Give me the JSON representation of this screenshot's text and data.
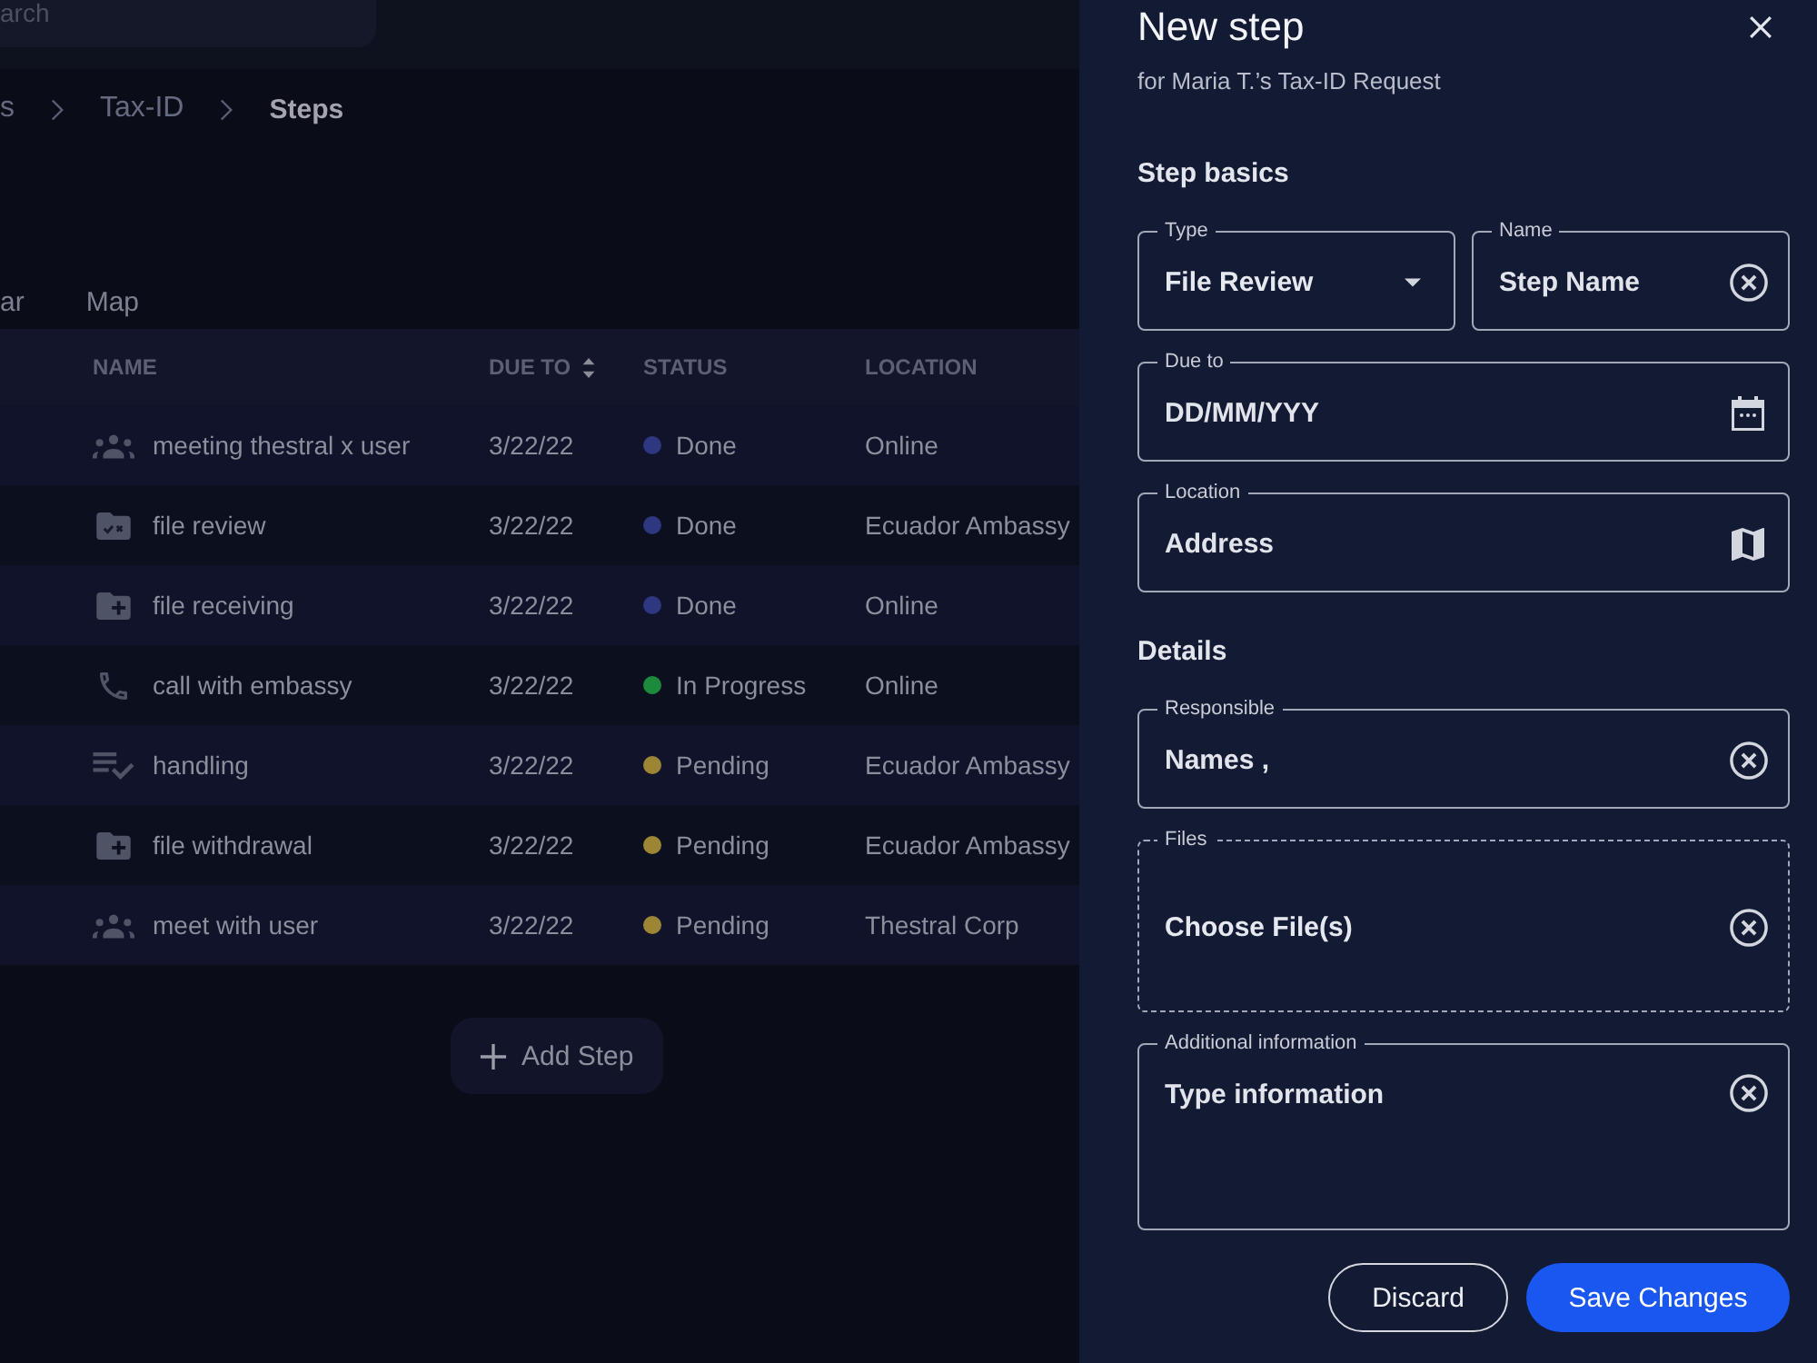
{
  "header": {
    "search": {
      "placeholder": "arch"
    }
  },
  "breadcrumb": [
    {
      "label": "s",
      "current": false
    },
    {
      "label": "Tax-ID",
      "current": false
    },
    {
      "label": "Steps",
      "current": true
    }
  ],
  "tabs": [
    {
      "label": "ar",
      "selected": false
    },
    {
      "label": "Map",
      "selected": false
    }
  ],
  "table": {
    "columns": [
      {
        "label": "NAME",
        "sortable": false
      },
      {
        "label": "DUE TO",
        "sortable": true
      },
      {
        "label": "STATUS",
        "sortable": false
      },
      {
        "label": "LOCATION",
        "sortable": false
      }
    ],
    "rows": [
      {
        "kind": "meeting",
        "name": "meeting thestral x user",
        "due_to": "3/22/22",
        "status": "Done",
        "color": "#2d3880",
        "location": "Online"
      },
      {
        "kind": "review",
        "name": "file review",
        "due_to": "3/22/22",
        "status": "Done",
        "color": "#2d3880",
        "location": "Ecuador Ambassy"
      },
      {
        "kind": "file",
        "name": "file receiving",
        "due_to": "3/22/22",
        "status": "Done",
        "color": "#2d3880",
        "location": "Online"
      },
      {
        "kind": "call",
        "name": "call with embassy",
        "due_to": "3/22/22",
        "status": "In Progress",
        "color": "#1c8a3c",
        "location": "Online"
      },
      {
        "kind": "checklist",
        "name": "handling",
        "due_to": "3/22/22",
        "status": "Pending",
        "color": "#9c8636",
        "location": "Ecuador Ambassy"
      },
      {
        "kind": "file",
        "name": "file withdrawal",
        "due_to": "3/22/22",
        "status": "Pending",
        "color": "#9c8636",
        "location": "Ecuador Ambassy"
      },
      {
        "kind": "meeting",
        "name": "meet with user",
        "due_to": "3/22/22",
        "status": "Pending",
        "color": "#9c8636",
        "location": "Thestral Corp"
      }
    ]
  },
  "add_step_button": {
    "label": "Add Step"
  },
  "panel": {
    "title": "New step",
    "subtitle": "for Maria T.’s Tax-ID Request",
    "sections": [
      {
        "title": "Step basics",
        "rows": [
          {
            "fields": [
              {
                "kind": "select",
                "label": "Type",
                "value": "File Review"
              },
              {
                "kind": "text",
                "label": "Name",
                "placeholder": "Step Name"
              }
            ]
          },
          {
            "fields": [
              {
                "kind": "date",
                "label": "Due to",
                "placeholder": "DD/MM/YYY"
              }
            ]
          },
          {
            "fields": [
              {
                "kind": "location",
                "label": "Location",
                "placeholder": "Address"
              }
            ]
          }
        ]
      },
      {
        "title": "Details",
        "rows": [
          {
            "fields": [
              {
                "kind": "text",
                "label": "Responsible",
                "placeholder": "Names ,"
              }
            ]
          },
          {
            "fields": [
              {
                "kind": "files",
                "label": "Files",
                "prompt": "Choose File(s)"
              }
            ]
          },
          {
            "fields": [
              {
                "kind": "textarea",
                "label": "Additional information",
                "placeholder": "Type information"
              }
            ]
          }
        ]
      }
    ],
    "buttons": [
      {
        "kind": "secondary",
        "label": "Discard"
      },
      {
        "kind": "primary",
        "label": "Save Changes"
      }
    ]
  }
}
